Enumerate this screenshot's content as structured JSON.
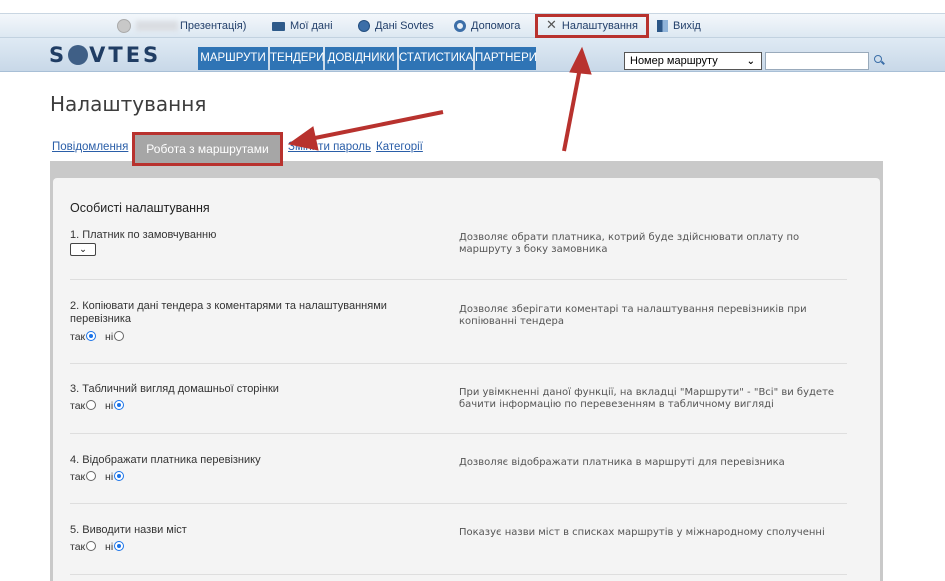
{
  "topbar": {
    "user_suffix": "Презентація)",
    "my_data": "Мої дані",
    "sovtes_data": "Дані Sovtes",
    "help": "Допомога",
    "settings": "Налаштування",
    "exit": "Вихід"
  },
  "logo": {
    "text_left": "S",
    "text_right": "VTES"
  },
  "nav": {
    "tabs": [
      "МАРШРУТИ",
      "ТЕНДЕРИ",
      "ДОВІДНИКИ",
      "СТАТИСТИКА",
      "ПАРТНЕРИ"
    ],
    "search_select": "Номер маршруту",
    "search_value": ""
  },
  "page": {
    "title": "Налаштування",
    "subtabs": [
      "Повідомлення",
      "Робота з маршрутами",
      "Змінити пароль",
      "Категорії"
    ]
  },
  "panel": {
    "title": "Особисті налаштування",
    "settings": [
      {
        "question": "1. Платник по замовчуванню",
        "description": "Дозволяє обрати платника, котрий буде здійснювати оплату по маршруту з боку замовника",
        "control": "select"
      },
      {
        "question": "2. Копіювати дані тендера з коментарями та налаштуваннями перевізника",
        "description": "Дозволяє зберігати коментарі та налаштування перевізників при копіюванні тендера",
        "yes_label": "так",
        "no_label": "ні",
        "selected": "yes"
      },
      {
        "question": "3. Табличний вигляд домашньої сторінки",
        "description": "При увімкненні даної функції, на вкладці \"Маршрути\" - \"Всі\" ви будете бачити інформацію по перевезенням в табличному вигляді",
        "yes_label": "так",
        "no_label": "ні",
        "selected": "no"
      },
      {
        "question": "4. Відображати платника перевізнику",
        "description": "Дозволяє відображати платника в маршруті для перевізника",
        "yes_label": "так",
        "no_label": "ні",
        "selected": "no"
      },
      {
        "question": "5. Виводити назви міст",
        "description": "Показує назви міст в списках маршрутів у міжнародному сполученні",
        "yes_label": "так",
        "no_label": "ні",
        "selected": "no"
      }
    ]
  },
  "colors": {
    "nav_tab": "#2f74b5",
    "highlight": "#b8322e",
    "active_subtab": "#a6a6a6"
  },
  "icons": [
    "user-icon",
    "id-card-icon",
    "globe-icon",
    "lifebuoy-icon",
    "tools-icon",
    "exit-door-icon",
    "search-icon",
    "chevron-down-icon"
  ]
}
